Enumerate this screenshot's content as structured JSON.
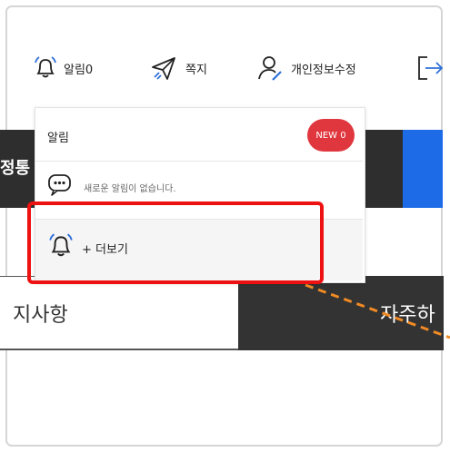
{
  "nav": {
    "alerts_label": "알림0",
    "messages_label": "쪽지",
    "profile_label": "개인정보수정"
  },
  "background": {
    "left_banner_text": "정통",
    "notice_tab_label": "지사항",
    "faq_tab_label": "자주하"
  },
  "popup": {
    "title": "알림",
    "badge": "NEW 0",
    "empty_message": "새로운 알림이 없습니다.",
    "more_label": "+ 더보기"
  },
  "colors": {
    "badge": "#e0373f",
    "highlight": "#ee1111",
    "arrow": "#f08a24",
    "blue_block": "#1e6be8",
    "dark_block": "#2e2e2e"
  },
  "icons": [
    "bell-icon",
    "paper-plane-icon",
    "user-edit-icon",
    "logout-icon",
    "chat-bubble-icon"
  ]
}
